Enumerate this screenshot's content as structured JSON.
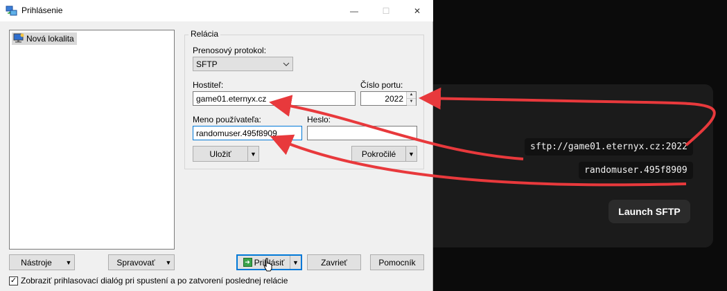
{
  "window": {
    "title": "Prihlásenie",
    "controls": {
      "minimize": "—",
      "maximize": "☐",
      "close": "✕"
    }
  },
  "sites": [
    {
      "label": "Nová lokalita"
    }
  ],
  "session": {
    "legend": "Relácia",
    "protocol_label": "Prenosový protokol:",
    "protocol_value": "SFTP",
    "host_label": "Hostiteľ:",
    "host_value": "game01.eternyx.cz",
    "port_label": "Číslo portu:",
    "port_value": "2022",
    "user_label": "Meno používateľa:",
    "user_value": "randomuser.495f8909",
    "password_label": "Heslo:",
    "password_value": "",
    "save_label": "Uložiť",
    "advanced_label": "Pokročilé"
  },
  "buttons": {
    "tools": "Nástroje",
    "manage": "Spravovať",
    "login": "Prihlásiť",
    "close": "Zavrieť",
    "help": "Pomocník"
  },
  "checkbox": {
    "label": "Zobraziť prihlasovací dialóg pri spustení a po zatvorení poslednej relácie",
    "checked": true
  },
  "overlay": {
    "sftp_url": "sftp://game01.eternyx.cz:2022",
    "username": "randomuser.495f8909",
    "launch_label": "Launch SFTP"
  },
  "colors": {
    "arrow": "#e8393c",
    "focus": "#0078d7"
  }
}
